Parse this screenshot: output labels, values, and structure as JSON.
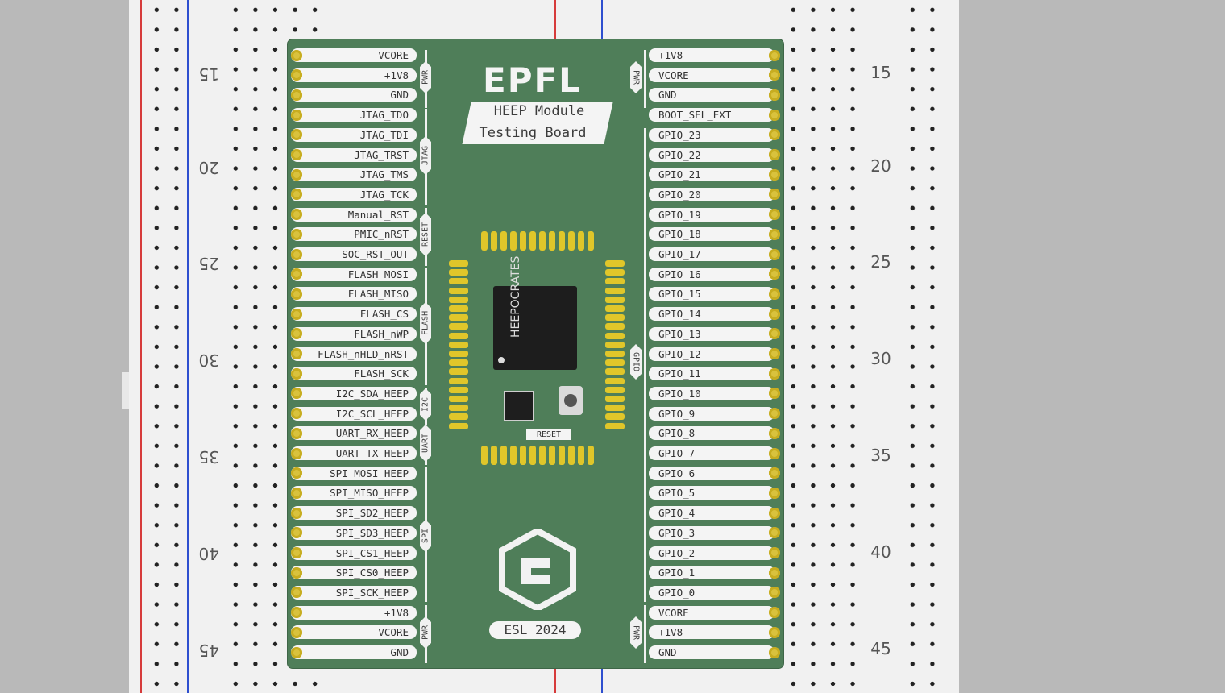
{
  "board": {
    "logo_text": "EPFL",
    "title_line1": "HEEP Module",
    "title_line2": "Testing Board",
    "footer_label": "ESL 2024",
    "chip_text": "HEEPOCRATES",
    "reset_label": "RESET"
  },
  "left_pins": [
    "VCORE",
    "+1V8",
    "GND",
    "JTAG_TDO",
    "JTAG_TDI",
    "JTAG_TRST",
    "JTAG_TMS",
    "JTAG_TCK",
    "Manual_RST",
    "PMIC_nRST",
    "SOC_RST_OUT",
    "FLASH_MOSI",
    "FLASH_MISO",
    "FLASH_CS",
    "FLASH_nWP",
    "FLASH_nHLD_nRST",
    "FLASH_SCK",
    "I2C_SDA_HEEP",
    "I2C_SCL_HEEP",
    "UART_RX_HEEP",
    "UART_TX_HEEP",
    "SPI_MOSI_HEEP",
    "SPI_MISO_HEEP",
    "SPI_SD2_HEEP",
    "SPI_SD3_HEEP",
    "SPI_CS1_HEEP",
    "SPI_CS0_HEEP",
    "SPI_SCK_HEEP",
    "+1V8",
    "VCORE",
    "GND"
  ],
  "right_pins": [
    "+1V8",
    "VCORE",
    "GND",
    "BOOT_SEL_EXT",
    "GPIO_23",
    "GPIO_22",
    "GPIO_21",
    "GPIO_20",
    "GPIO_19",
    "GPIO_18",
    "GPIO_17",
    "GPIO_16",
    "GPIO_15",
    "GPIO_14",
    "GPIO_13",
    "GPIO_12",
    "GPIO_11",
    "GPIO_10",
    "GPIO_9",
    "GPIO_8",
    "GPIO_7",
    "GPIO_6",
    "GPIO_5",
    "GPIO_4",
    "GPIO_3",
    "GPIO_2",
    "GPIO_1",
    "GPIO_0",
    "VCORE",
    "+1V8",
    "GND"
  ],
  "groups_left": [
    "PWR",
    "JTAG",
    "RESET",
    "FLASH",
    "I2C",
    "UART",
    "SPI",
    "PWR"
  ],
  "groups_right": [
    "PWR",
    "GPIO",
    "PWR"
  ],
  "breadboard": {
    "left_numbers": [
      "15",
      "20",
      "25",
      "30",
      "35",
      "40",
      "45"
    ],
    "right_numbers": [
      "15",
      "20",
      "25",
      "30",
      "35",
      "40",
      "45"
    ]
  },
  "colors": {
    "pcb": "#4f7e59",
    "pad": "#e0c62a",
    "rail_red": "#d63b3b",
    "rail_blue": "#2e4fcf"
  }
}
